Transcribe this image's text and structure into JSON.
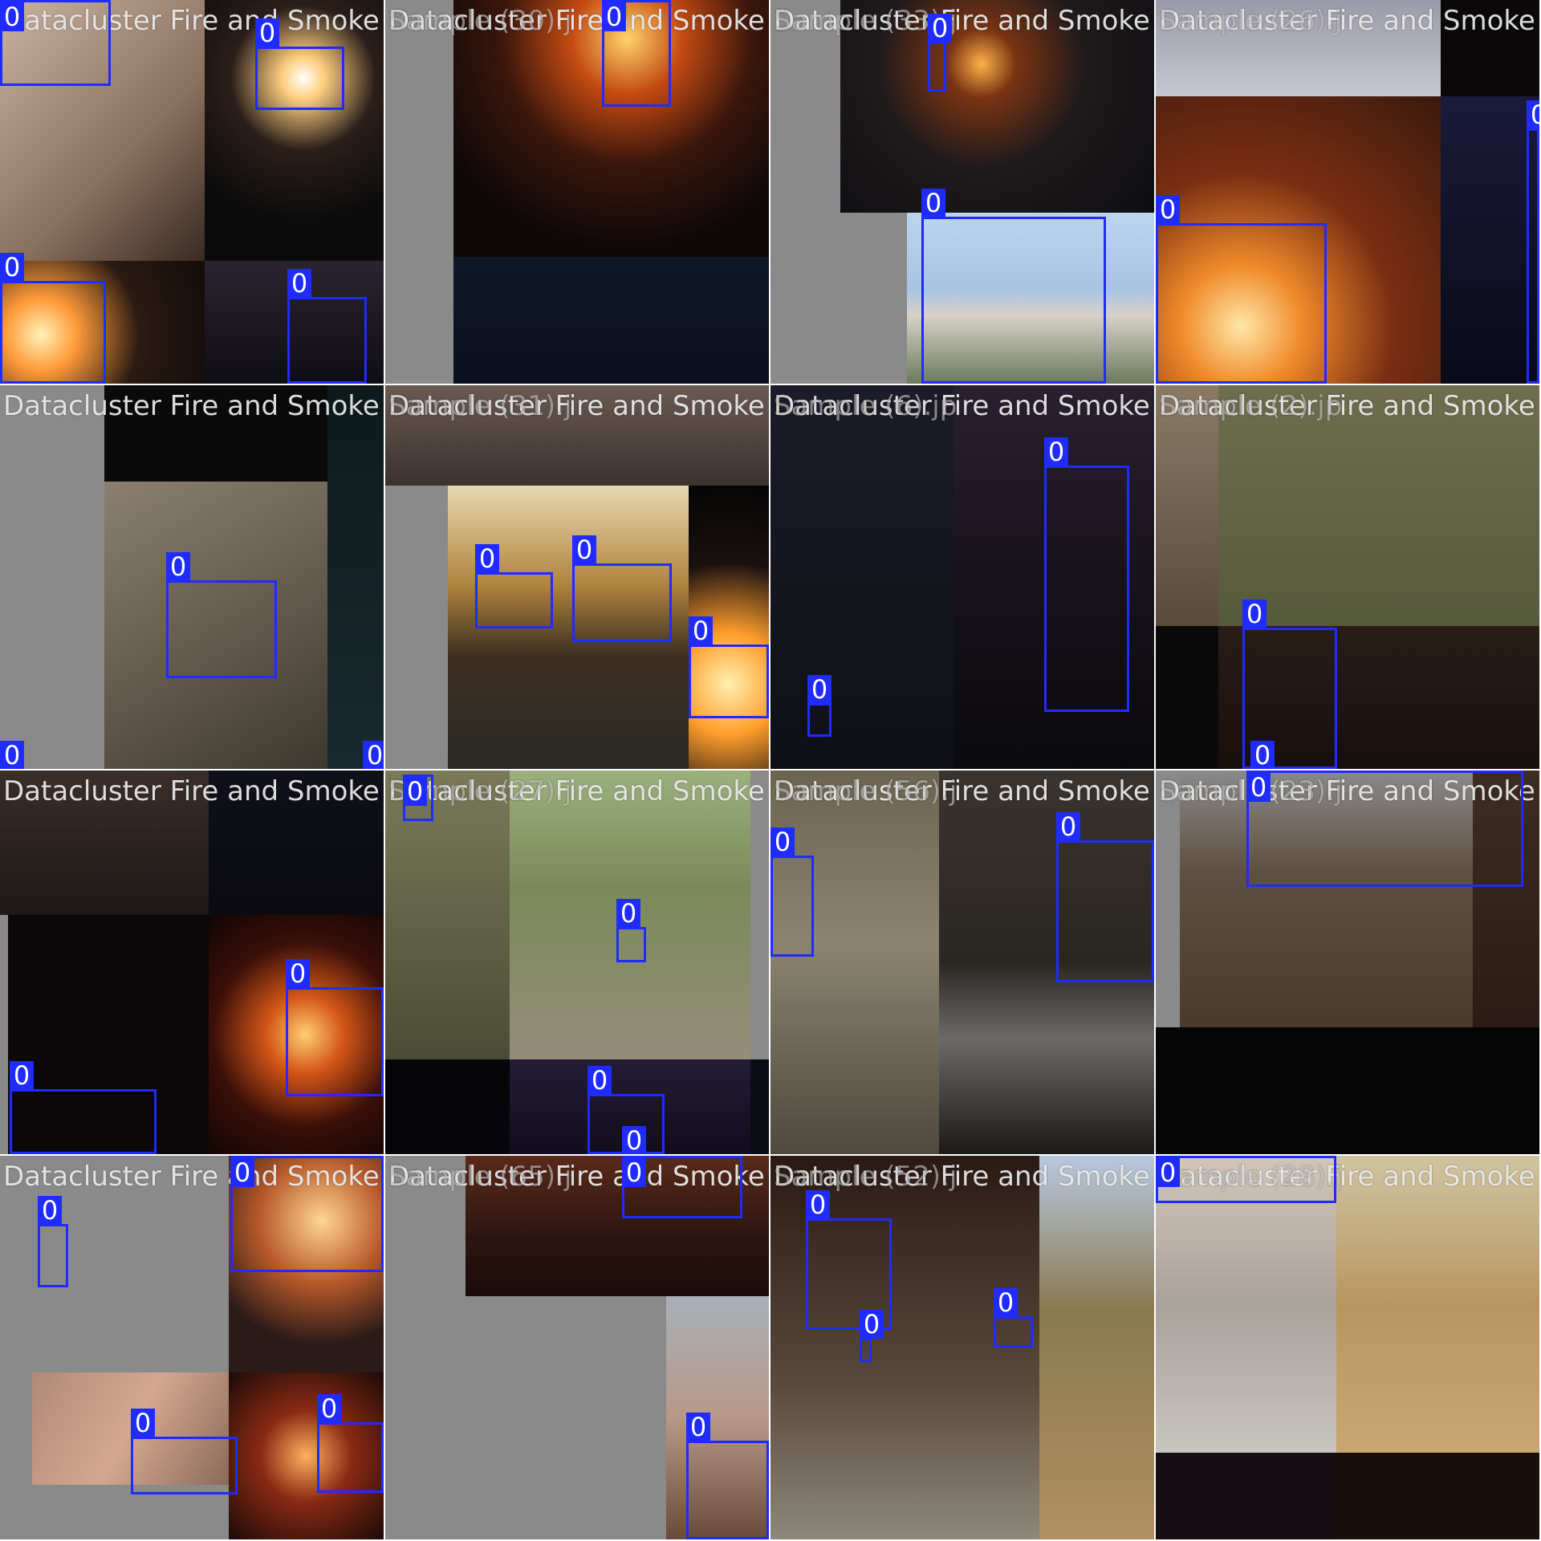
{
  "mosaic": {
    "description_label": "Training batch mosaic",
    "box_color": "#1f2bff",
    "cells": [
      {
        "title": "Datacluster Fire and Smoke Sample",
        "second_title": "",
        "class_labels": [
          "0",
          "0",
          "0",
          "0"
        ]
      },
      {
        "title": "Datacluster Fire and Smoke Sample",
        "second_title": "Sample (30).j",
        "class_labels": [
          "0"
        ]
      },
      {
        "title": "Datacluster Fire and Smoke Sample",
        "second_title": "Sample (33).j",
        "class_labels": [
          "0",
          "0"
        ]
      },
      {
        "title": "Datacluster Fire and Smoke Sample",
        "second_title": "Sample (26).j",
        "class_labels": [
          "0",
          "0"
        ]
      },
      {
        "title": "Datacluster Fire and Smoke Sample",
        "second_title": "",
        "class_labels": [
          "0",
          "0",
          "0"
        ]
      },
      {
        "title": "Datacluster Fire and Smoke Sample",
        "second_title": "Sample (31).j",
        "class_labels": [
          "0",
          "0",
          "0"
        ]
      },
      {
        "title": "Datacluster Fire and Smoke Sample",
        "second_title": "Sample (6).jp",
        "class_labels": [
          "0",
          "0"
        ]
      },
      {
        "title": "Datacluster Fire and Smoke Sample",
        "second_title": "Sample (2).jp",
        "class_labels": [
          "0",
          "0"
        ]
      },
      {
        "title": "Datacluster Fire and Smoke Sample",
        "second_title": "",
        "class_labels": [
          "0",
          "0"
        ]
      },
      {
        "title": "Datacluster Fire and Smoke Sample",
        "second_title": "Sample (27).j",
        "class_labels": [
          "0",
          "0",
          "0",
          "0"
        ]
      },
      {
        "title": "Datacluster Fire and Smoke Sample",
        "second_title": "Sample (56).j",
        "class_labels": [
          "0",
          "0"
        ]
      },
      {
        "title": "Datacluster Fire and Smoke Sample",
        "second_title": "Sample (23).j",
        "class_labels": [
          "0"
        ]
      },
      {
        "title": "Datacluster Fire and Smoke Sample",
        "second_title": "",
        "class_labels": [
          "0",
          "0",
          "0",
          "0"
        ]
      },
      {
        "title": "Datacluster Fire and Smoke Sample",
        "second_title": "Sample (65).j",
        "class_labels": [
          "0",
          "0"
        ]
      },
      {
        "title": "Datacluster Fire and Smoke Sample",
        "second_title": "Sample (52).j",
        "class_labels": [
          "0",
          "0",
          "0"
        ]
      },
      {
        "title": "Datacluster Fire and Smoke Sample",
        "second_title": "Sample (28).j",
        "class_labels": [
          "0"
        ]
      }
    ]
  }
}
